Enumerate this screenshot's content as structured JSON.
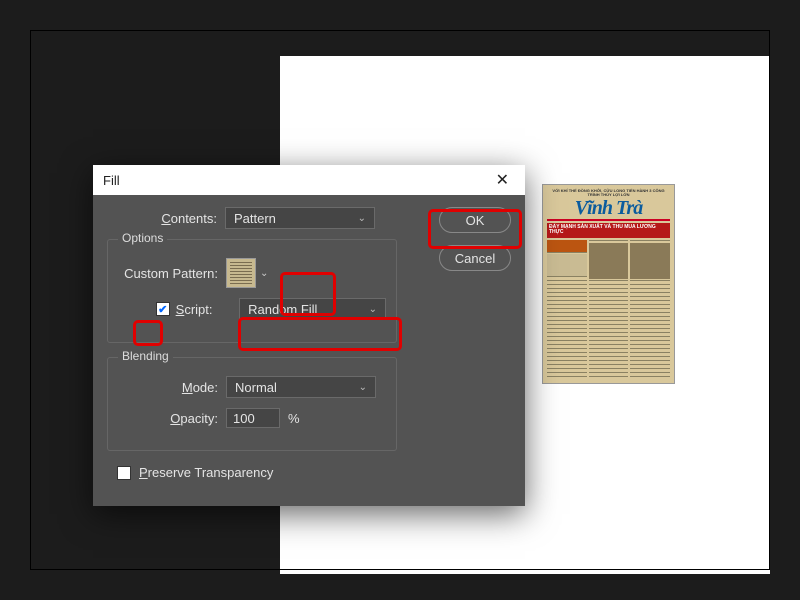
{
  "dialog": {
    "title": "Fill",
    "contents_label": "Contents:",
    "contents_value": "Pattern",
    "ok_label": "OK",
    "cancel_label": "Cancel",
    "options": {
      "legend": "Options",
      "custom_pattern_label": "Custom Pattern:",
      "script_checked": true,
      "script_label": "Script:",
      "script_value": "Random Fill"
    },
    "blending": {
      "legend": "Blending",
      "mode_label": "Mode:",
      "mode_value": "Normal",
      "opacity_label": "Opacity:",
      "opacity_value": "100",
      "opacity_suffix": "%"
    },
    "preserve_transparency_label": "Preserve Transparency",
    "preserve_transparency_checked": false
  },
  "newspaper": {
    "pretitle": "VỚI KHÍ THẾ ĐỒNG KHỞI, CỬU LONG TIẾN HÀNH 3 CÔNG TRÌNH THỦY LỢI LỚN",
    "title": "Vĩnh Trà",
    "banner": "ĐẨY MẠNH SẢN XUẤT VÀ THU MUA LƯƠNG THỰC"
  }
}
